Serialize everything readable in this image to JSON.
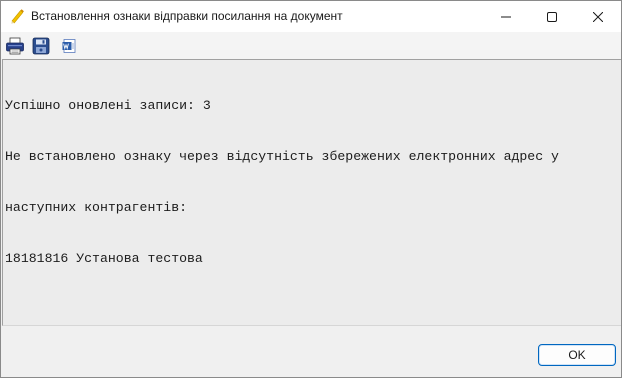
{
  "window": {
    "title": "Встановлення ознаки відправки посилання на документ"
  },
  "toolbar": {
    "icons": [
      "printer-icon",
      "save-icon",
      "word-icon"
    ]
  },
  "message": {
    "lines": [
      "Успішно оновлені записи: 3",
      "Не встановлено ознаку через відсутність збережених електронних адрес у",
      "наступних контрагентів:",
      "18181816 Установа тестова"
    ]
  },
  "footer": {
    "ok_label": "OK"
  },
  "colors": {
    "accent": "#0067c0",
    "background": "#f0f0f0",
    "text_area": "#ececec"
  }
}
